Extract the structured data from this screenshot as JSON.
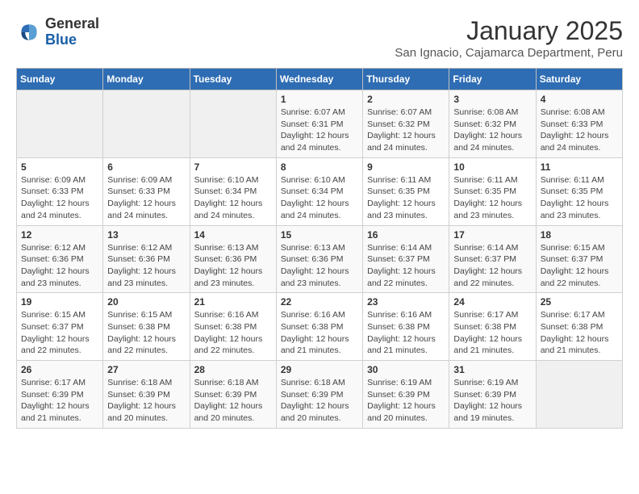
{
  "header": {
    "logo": {
      "general": "General",
      "blue": "Blue"
    },
    "title": "January 2025",
    "subtitle": "San Ignacio, Cajamarca Department, Peru"
  },
  "calendar": {
    "weekdays": [
      "Sunday",
      "Monday",
      "Tuesday",
      "Wednesday",
      "Thursday",
      "Friday",
      "Saturday"
    ],
    "weeks": [
      [
        {
          "day": "",
          "info": ""
        },
        {
          "day": "",
          "info": ""
        },
        {
          "day": "",
          "info": ""
        },
        {
          "day": "1",
          "sunrise": "6:07 AM",
          "sunset": "6:31 PM",
          "daylight": "12 hours and 24 minutes."
        },
        {
          "day": "2",
          "sunrise": "6:07 AM",
          "sunset": "6:32 PM",
          "daylight": "12 hours and 24 minutes."
        },
        {
          "day": "3",
          "sunrise": "6:08 AM",
          "sunset": "6:32 PM",
          "daylight": "12 hours and 24 minutes."
        },
        {
          "day": "4",
          "sunrise": "6:08 AM",
          "sunset": "6:33 PM",
          "daylight": "12 hours and 24 minutes."
        }
      ],
      [
        {
          "day": "5",
          "sunrise": "6:09 AM",
          "sunset": "6:33 PM",
          "daylight": "12 hours and 24 minutes."
        },
        {
          "day": "6",
          "sunrise": "6:09 AM",
          "sunset": "6:33 PM",
          "daylight": "12 hours and 24 minutes."
        },
        {
          "day": "7",
          "sunrise": "6:10 AM",
          "sunset": "6:34 PM",
          "daylight": "12 hours and 24 minutes."
        },
        {
          "day": "8",
          "sunrise": "6:10 AM",
          "sunset": "6:34 PM",
          "daylight": "12 hours and 24 minutes."
        },
        {
          "day": "9",
          "sunrise": "6:11 AM",
          "sunset": "6:35 PM",
          "daylight": "12 hours and 23 minutes."
        },
        {
          "day": "10",
          "sunrise": "6:11 AM",
          "sunset": "6:35 PM",
          "daylight": "12 hours and 23 minutes."
        },
        {
          "day": "11",
          "sunrise": "6:11 AM",
          "sunset": "6:35 PM",
          "daylight": "12 hours and 23 minutes."
        }
      ],
      [
        {
          "day": "12",
          "sunrise": "6:12 AM",
          "sunset": "6:36 PM",
          "daylight": "12 hours and 23 minutes."
        },
        {
          "day": "13",
          "sunrise": "6:12 AM",
          "sunset": "6:36 PM",
          "daylight": "12 hours and 23 minutes."
        },
        {
          "day": "14",
          "sunrise": "6:13 AM",
          "sunset": "6:36 PM",
          "daylight": "12 hours and 23 minutes."
        },
        {
          "day": "15",
          "sunrise": "6:13 AM",
          "sunset": "6:36 PM",
          "daylight": "12 hours and 23 minutes."
        },
        {
          "day": "16",
          "sunrise": "6:14 AM",
          "sunset": "6:37 PM",
          "daylight": "12 hours and 22 minutes."
        },
        {
          "day": "17",
          "sunrise": "6:14 AM",
          "sunset": "6:37 PM",
          "daylight": "12 hours and 22 minutes."
        },
        {
          "day": "18",
          "sunrise": "6:15 AM",
          "sunset": "6:37 PM",
          "daylight": "12 hours and 22 minutes."
        }
      ],
      [
        {
          "day": "19",
          "sunrise": "6:15 AM",
          "sunset": "6:37 PM",
          "daylight": "12 hours and 22 minutes."
        },
        {
          "day": "20",
          "sunrise": "6:15 AM",
          "sunset": "6:38 PM",
          "daylight": "12 hours and 22 minutes."
        },
        {
          "day": "21",
          "sunrise": "6:16 AM",
          "sunset": "6:38 PM",
          "daylight": "12 hours and 22 minutes."
        },
        {
          "day": "22",
          "sunrise": "6:16 AM",
          "sunset": "6:38 PM",
          "daylight": "12 hours and 21 minutes."
        },
        {
          "day": "23",
          "sunrise": "6:16 AM",
          "sunset": "6:38 PM",
          "daylight": "12 hours and 21 minutes."
        },
        {
          "day": "24",
          "sunrise": "6:17 AM",
          "sunset": "6:38 PM",
          "daylight": "12 hours and 21 minutes."
        },
        {
          "day": "25",
          "sunrise": "6:17 AM",
          "sunset": "6:38 PM",
          "daylight": "12 hours and 21 minutes."
        }
      ],
      [
        {
          "day": "26",
          "sunrise": "6:17 AM",
          "sunset": "6:39 PM",
          "daylight": "12 hours and 21 minutes."
        },
        {
          "day": "27",
          "sunrise": "6:18 AM",
          "sunset": "6:39 PM",
          "daylight": "12 hours and 20 minutes."
        },
        {
          "day": "28",
          "sunrise": "6:18 AM",
          "sunset": "6:39 PM",
          "daylight": "12 hours and 20 minutes."
        },
        {
          "day": "29",
          "sunrise": "6:18 AM",
          "sunset": "6:39 PM",
          "daylight": "12 hours and 20 minutes."
        },
        {
          "day": "30",
          "sunrise": "6:19 AM",
          "sunset": "6:39 PM",
          "daylight": "12 hours and 20 minutes."
        },
        {
          "day": "31",
          "sunrise": "6:19 AM",
          "sunset": "6:39 PM",
          "daylight": "12 hours and 19 minutes."
        },
        {
          "day": "",
          "info": ""
        }
      ]
    ]
  }
}
